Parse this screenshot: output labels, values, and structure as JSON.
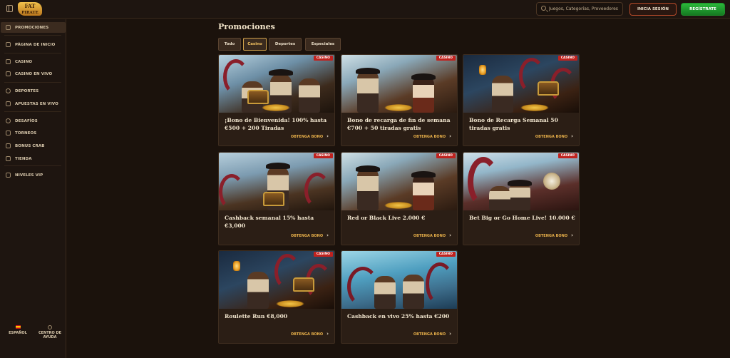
{
  "header": {
    "logo_line1": "FAT",
    "logo_line2": "PIRATE",
    "search_placeholder": "Juegos, Categorías, Proveedores",
    "login_label": "INICIA SESIÓN",
    "register_label": "REGÍSTRATE"
  },
  "sidebar": {
    "items": [
      {
        "label": "PROMOCIONES",
        "icon": "gift-icon",
        "active": true
      },
      {
        "label": "PÁGINA DE INICIO",
        "icon": "home-icon"
      },
      {
        "label": "CASINO",
        "icon": "cards-icon"
      },
      {
        "label": "CASINO EN VIVO",
        "icon": "live-casino-icon"
      },
      {
        "label": "DEPORTES",
        "icon": "ball-icon"
      },
      {
        "label": "APUESTAS EN VIVO",
        "icon": "live-bet-icon"
      },
      {
        "label": "DESAFÍOS",
        "icon": "challenge-icon"
      },
      {
        "label": "TORNEOS",
        "icon": "trophy-icon"
      },
      {
        "label": "BONUS CRAB",
        "icon": "crab-icon"
      },
      {
        "label": "TIENDA",
        "icon": "shop-icon"
      },
      {
        "label": "NIVELES VIP",
        "icon": "crown-icon"
      }
    ],
    "footer": {
      "language": "ESPAÑOL",
      "help_line1": "CENTRO DE",
      "help_line2": "AYUDA"
    }
  },
  "main": {
    "title": "Promociones",
    "tabs": [
      {
        "label": "Todo",
        "active": false
      },
      {
        "label": "Casino",
        "active": true
      },
      {
        "label": "Deportes",
        "active": false
      },
      {
        "label": "Especiales",
        "active": false
      }
    ],
    "card_badge": "CASINO",
    "card_button": "OBTENGA BONO",
    "cards": [
      {
        "title": "¡Bono de Bienvenida! 100% hasta €500 + 200 Tiradas",
        "scene": "pirate-crew-icon"
      },
      {
        "title": "Bono de recarga de fin de semana €700 + 50 tiradas gratis",
        "scene": "pirate-duo-icon"
      },
      {
        "title": "Bono de Recarga Semanal 50 tiradas gratis",
        "scene": "kraken-chest-icon"
      },
      {
        "title": "Cashback semanal 15% hasta €3,000",
        "scene": "pirate-treasure-icon"
      },
      {
        "title": "Red or Black Live 2.000 €",
        "scene": "pirate-duo-icon"
      },
      {
        "title": "Bet Big or Go Home Live! 10.000 €",
        "scene": "kraken-compass-icon"
      },
      {
        "title": "Roulette Run €8,000",
        "scene": "kraken-chest-icon"
      },
      {
        "title": "Cashback en vivo 25% hasta €200",
        "scene": "kraken-sea-icon"
      }
    ]
  },
  "colors": {
    "background": "#1b120c",
    "sidebar": "#1e1510",
    "card": "#2b1e15",
    "accent_gold": "#e8b04a",
    "badge_red": "#c0221e",
    "register_green": "#2bb83a"
  }
}
